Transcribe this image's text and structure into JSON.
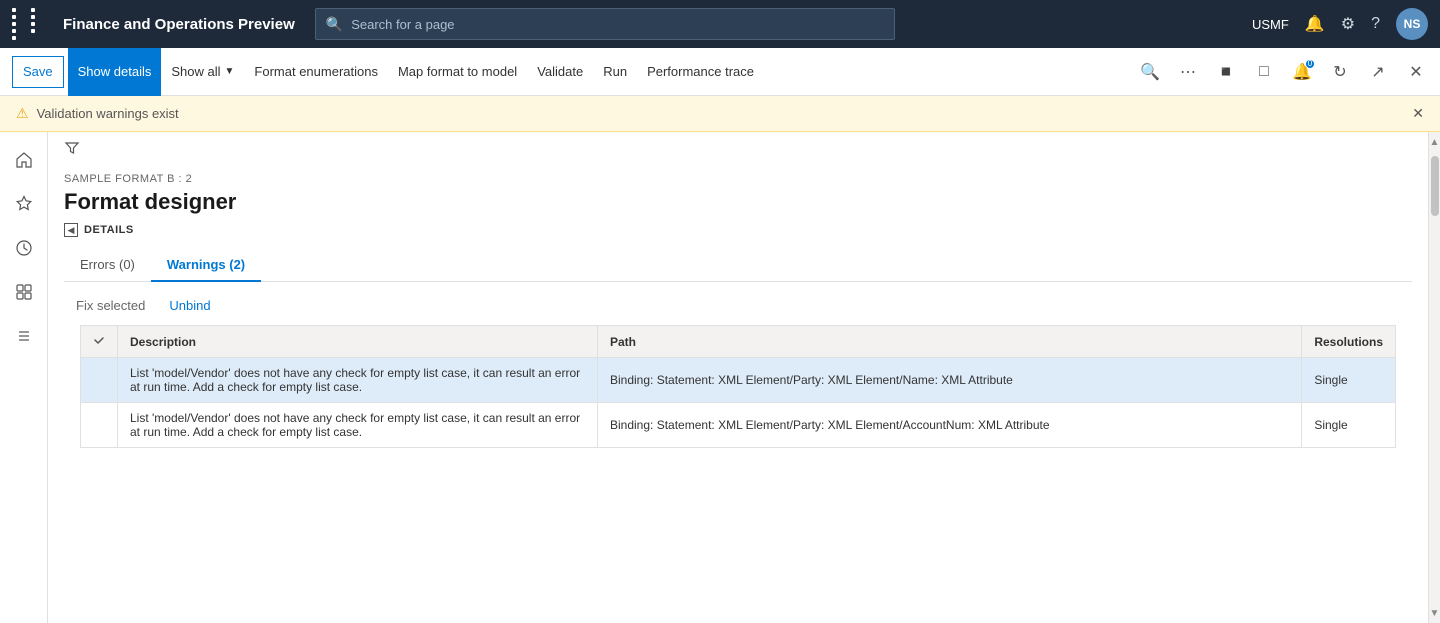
{
  "app": {
    "title": "Finance and Operations Preview",
    "user": "USMF",
    "avatar": "NS"
  },
  "search": {
    "placeholder": "Search for a page"
  },
  "toolbar": {
    "save_label": "Save",
    "show_details_label": "Show details",
    "show_all_label": "Show all",
    "format_enumerations_label": "Format enumerations",
    "map_format_label": "Map format to model",
    "validate_label": "Validate",
    "run_label": "Run",
    "performance_trace_label": "Performance trace"
  },
  "warning_bar": {
    "message": "Validation warnings exist"
  },
  "page": {
    "subtitle": "SAMPLE FORMAT B : 2",
    "title": "Format designer"
  },
  "details": {
    "label": "DETAILS",
    "tabs": [
      {
        "id": "errors",
        "label": "Errors (0)"
      },
      {
        "id": "warnings",
        "label": "Warnings (2)"
      }
    ],
    "active_tab": "warnings"
  },
  "actions": {
    "fix_selected": "Fix selected",
    "unbind": "Unbind"
  },
  "table": {
    "columns": [
      {
        "id": "check",
        "label": ""
      },
      {
        "id": "description",
        "label": "Description"
      },
      {
        "id": "path",
        "label": "Path"
      },
      {
        "id": "resolutions",
        "label": "Resolutions"
      }
    ],
    "rows": [
      {
        "selected": true,
        "description": "List 'model/Vendor' does not have any check for empty list case, it can result an error at run time. Add a check for empty list case.",
        "path": "Binding: Statement: XML Element/Party: XML Element/Name: XML Attribute",
        "resolutions": "Single"
      },
      {
        "selected": false,
        "description": "List 'model/Vendor' does not have any check for empty list case, it can result an error at run time. Add a check for empty list case.",
        "path": "Binding: Statement: XML Element/Party: XML Element/AccountNum: XML Attribute",
        "resolutions": "Single"
      }
    ]
  }
}
